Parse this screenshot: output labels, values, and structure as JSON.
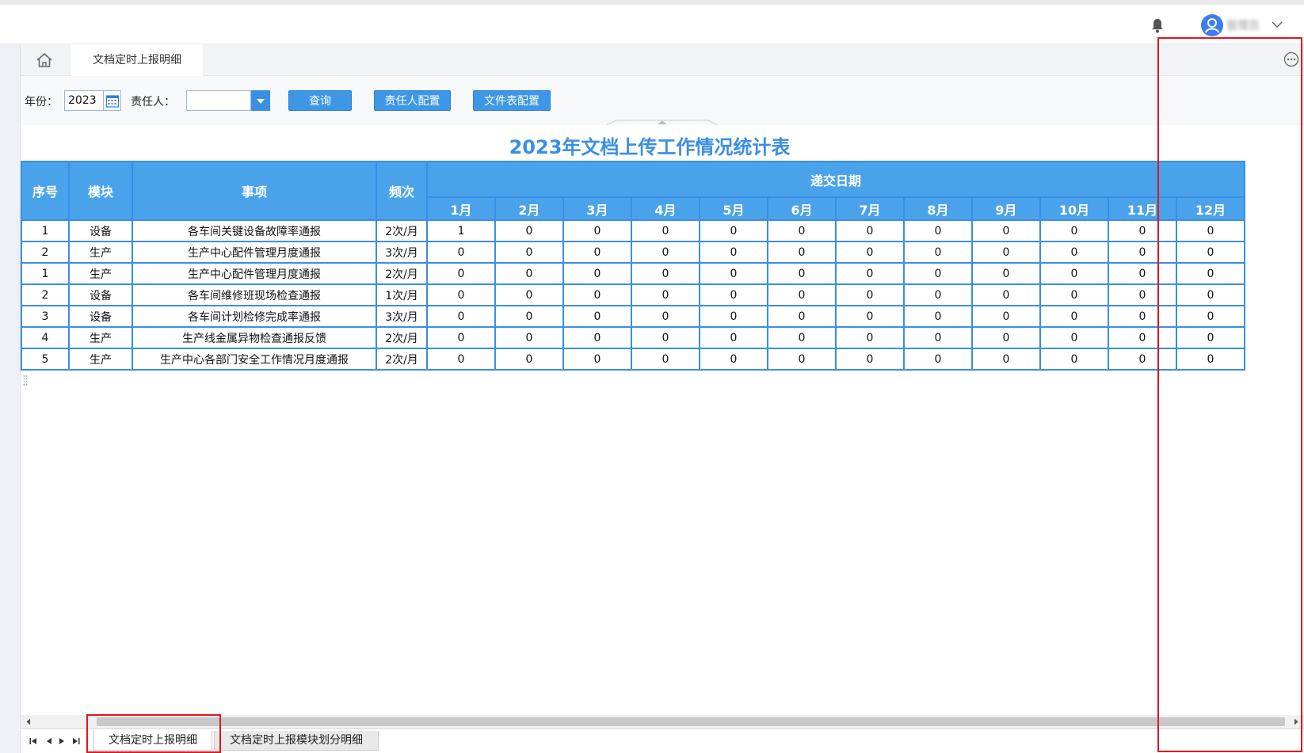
{
  "header": {
    "user_name": "管理员"
  },
  "tabs": {
    "current_tab": "文档定时上报明细"
  },
  "toolbar": {
    "year_label": "年份：",
    "year_value": "2023",
    "owner_label": "责任人：",
    "owner_value": "",
    "query_button": "查询",
    "owner_config_button": "责任人配置",
    "file_table_config_button": "文件表配置"
  },
  "report": {
    "title": "2023年文档上传工作情况统计表",
    "columns": {
      "index": "序号",
      "module": "模块",
      "item": "事项",
      "frequency": "频次",
      "submit_date": "递交日期"
    },
    "months": [
      "1月",
      "2月",
      "3月",
      "4月",
      "5月",
      "6月",
      "7月",
      "8月",
      "9月",
      "10月",
      "11月",
      "12月"
    ],
    "rows": [
      {
        "index": "1",
        "module": "设备",
        "item": "各车间关键设备故障率通报",
        "frequency": "2次/月",
        "values": [
          "1",
          "0",
          "0",
          "0",
          "0",
          "0",
          "0",
          "0",
          "0",
          "0",
          "0",
          "0"
        ]
      },
      {
        "index": "2",
        "module": "生产",
        "item": "生产中心配件管理月度通报",
        "frequency": "3次/月",
        "values": [
          "0",
          "0",
          "0",
          "0",
          "0",
          "0",
          "0",
          "0",
          "0",
          "0",
          "0",
          "0"
        ]
      },
      {
        "index": "1",
        "module": "生产",
        "item": "生产中心配件管理月度通报",
        "frequency": "2次/月",
        "values": [
          "0",
          "0",
          "0",
          "0",
          "0",
          "0",
          "0",
          "0",
          "0",
          "0",
          "0",
          "0"
        ]
      },
      {
        "index": "2",
        "module": "设备",
        "item": "各车间维修班现场检查通报",
        "frequency": "1次/月",
        "values": [
          "0",
          "0",
          "0",
          "0",
          "0",
          "0",
          "0",
          "0",
          "0",
          "0",
          "0",
          "0"
        ]
      },
      {
        "index": "3",
        "module": "设备",
        "item": "各车间计划检修完成率通报",
        "frequency": "3次/月",
        "values": [
          "0",
          "0",
          "0",
          "0",
          "0",
          "0",
          "0",
          "0",
          "0",
          "0",
          "0",
          "0"
        ]
      },
      {
        "index": "4",
        "module": "生产",
        "item": "生产线金属异物检查通报反馈",
        "frequency": "2次/月",
        "values": [
          "0",
          "0",
          "0",
          "0",
          "0",
          "0",
          "0",
          "0",
          "0",
          "0",
          "0",
          "0"
        ]
      },
      {
        "index": "5",
        "module": "生产",
        "item": "生产中心各部门安全工作情况月度通报",
        "frequency": "2次/月",
        "values": [
          "0",
          "0",
          "0",
          "0",
          "0",
          "0",
          "0",
          "0",
          "0",
          "0",
          "0",
          "0"
        ]
      }
    ]
  },
  "sheets": [
    "文档定时上报明细",
    "文档定时上报模块划分明细"
  ],
  "colors": {
    "accent": "#3a8ee6",
    "header_fill": "#4aa3ea",
    "highlight": "#e0161b"
  }
}
